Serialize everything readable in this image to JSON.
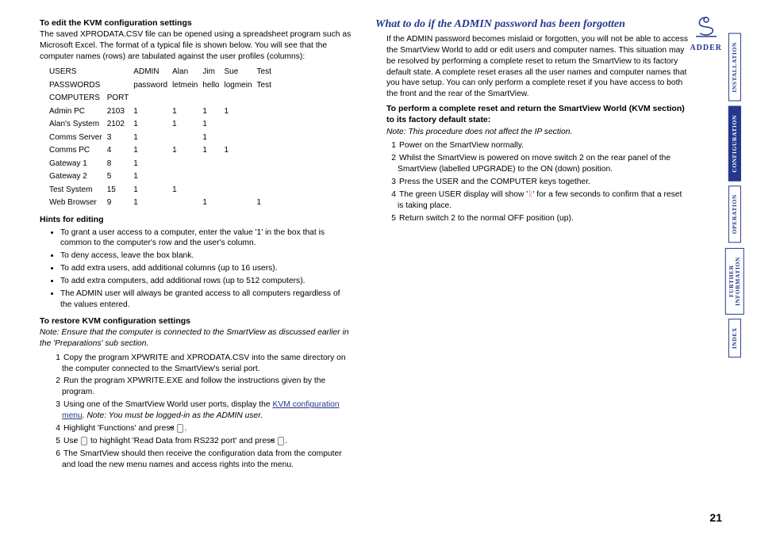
{
  "page_number": "21",
  "logo": {
    "text": "ADDER"
  },
  "side_tabs": [
    {
      "label": "INSTALLATION",
      "active": false
    },
    {
      "label": "CONFIGURATION",
      "active": true
    },
    {
      "label": "OPERATION",
      "active": false
    },
    {
      "label_line1": "FURTHER",
      "label_line2": "INFORMATION",
      "active": false
    },
    {
      "label": "INDEX",
      "active": false
    }
  ],
  "left": {
    "h_edit": "To edit the KVM configuration settings",
    "p_edit": "The saved XPRODATA.CSV file can be opened using a spreadsheet program such as Microsoft Excel. The format of a typical file is shown below. You will see that the computer names (rows) are tabulated against the user profiles (columns):",
    "table": {
      "r1": [
        "USERS",
        "",
        "ADMIN",
        "Alan",
        "Jim",
        "Sue",
        "Test"
      ],
      "r2": [
        "PASSWORDS",
        "",
        "password",
        "letmein",
        "hello",
        "logmein",
        "Test"
      ],
      "r3": [
        "COMPUTERS",
        "PORT",
        "",
        "",
        "",
        "",
        ""
      ],
      "rows": [
        [
          "Admin PC",
          "2103",
          "1",
          "1",
          "1",
          "1",
          ""
        ],
        [
          "Alan's System",
          "2102",
          "1",
          "1",
          "1",
          "",
          ""
        ],
        [
          "Comms Server",
          "3",
          "1",
          "",
          "1",
          "",
          ""
        ],
        [
          "Comms PC",
          "4",
          "1",
          "1",
          "1",
          "1",
          ""
        ],
        [
          "Gateway 1",
          "8",
          "1",
          "",
          "",
          "",
          ""
        ],
        [
          "Gateway 2",
          "5",
          "1",
          "",
          "",
          "",
          ""
        ],
        [
          "Test System",
          "15",
          "1",
          "1",
          "",
          "",
          ""
        ],
        [
          "Web Browser",
          "9",
          "1",
          "",
          "1",
          "",
          "1"
        ]
      ]
    },
    "h_hints": "Hints for editing",
    "hints": [
      "To grant a user access to a computer, enter the value '1' in the box that is common to the computer's row and the user's column.",
      "To deny access, leave the box blank.",
      "To add extra users, add additional columns (up to 16 users).",
      "To add extra computers, add additional rows (up to 512 computers).",
      "The ADMIN user will always be granted access to all computers regardless of the values entered."
    ],
    "h_restore": "To restore KVM configuration settings",
    "restore_note": "Note: Ensure that the computer is connected to the SmartView as discussed earlier in the 'Preparations' sub section.",
    "restore_steps": {
      "s1": "Copy the program XPWRITE and XPRODATA.CSV into the same directory on the computer connected to the SmartView's serial port.",
      "s2": "Run the program XPWRITE.EXE and follow the instructions given by the program.",
      "s3a": "Using one of the SmartView World user ports, display the ",
      "s3_link": "KVM configuration menu",
      "s3b": ". Note: You must be logged-in as the ADMIN user.",
      "s4a": "Highlight 'Functions' and press ",
      "s5a": "Use ",
      "s5b": " to highlight 'Read Data from RS232 port' and press ",
      "s6": "The SmartView should then receive the configuration data from the computer and load the new menu names and access rights into the menu."
    },
    "keys": {
      "enter": "↵",
      "down": "↓"
    }
  },
  "right": {
    "h_forgot": "What to do if the ADMIN password has been forgotten",
    "p_forgot": "If the ADMIN password becomes mislaid or forgotten, you will not be able to access the SmartView World to add or edit users and computer names. This situation may be resolved by performing a complete reset to return the SmartView to its factory default state. A complete reset erases all the user names and computer names that you have setup. You can only perform a complete reset if you have access to both the front and the rear of the SmartView.",
    "h_reset": "To perform a complete reset and return the SmartView World (KVM section) to its factory default state:",
    "reset_note": "Note: This procedure does not affect the IP section.",
    "reset_steps": {
      "s1": "Power on the SmartView normally.",
      "s2": "Whilst the SmartView is powered on move switch 2 on the rear panel of the SmartView (labelled UPGRADE) to the ON (down) position.",
      "s3": "Press the USER and the COMPUTER keys together.",
      "s4a": "The green USER display will show '",
      "s4_glyph": "ᚱ",
      "s4b": "' for a few seconds to confirm that a reset is taking place.",
      "s5": "Return switch 2 to the normal OFF position (up)."
    }
  }
}
